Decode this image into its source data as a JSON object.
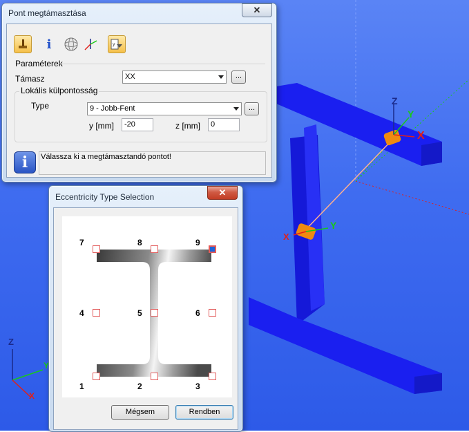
{
  "viewport": {
    "axis_labels": {
      "z": "Z",
      "y": "Y",
      "x": "X"
    },
    "colors": {
      "background": "#3f6cf0",
      "beam": "#1a1ff0",
      "x_axis": "#e0201a",
      "y_axis": "#19c919",
      "z_axis": "#1b2a8a"
    }
  },
  "main_window": {
    "title": "Pont megtámasztása",
    "toolbar": [
      "support-icon",
      "info-icon",
      "sphere-icon",
      "axes-icon",
      "eccentricity-icon"
    ],
    "section_label": "Paraméterek",
    "support_label": "Támasz",
    "support_value": "XX",
    "browse_label": "...",
    "eccentricity_group": "Lokális külpontosság",
    "type_label": "Type",
    "type_value": "9 - Jobb-Fent",
    "y_label": "y [mm]",
    "y_value": "-20",
    "z_label": "z [mm]",
    "z_value": "0",
    "message": "Válassza ki a megtámasztandó pontot!",
    "close_symbol": "✕"
  },
  "ecc_dialog": {
    "title": "Eccentricity Type Selection",
    "close_symbol": "✕",
    "positions": [
      "1",
      "2",
      "3",
      "4",
      "5",
      "6",
      "7",
      "8",
      "9"
    ],
    "selected": "9",
    "cancel_label": "Mégsem",
    "ok_label": "Rendben"
  }
}
